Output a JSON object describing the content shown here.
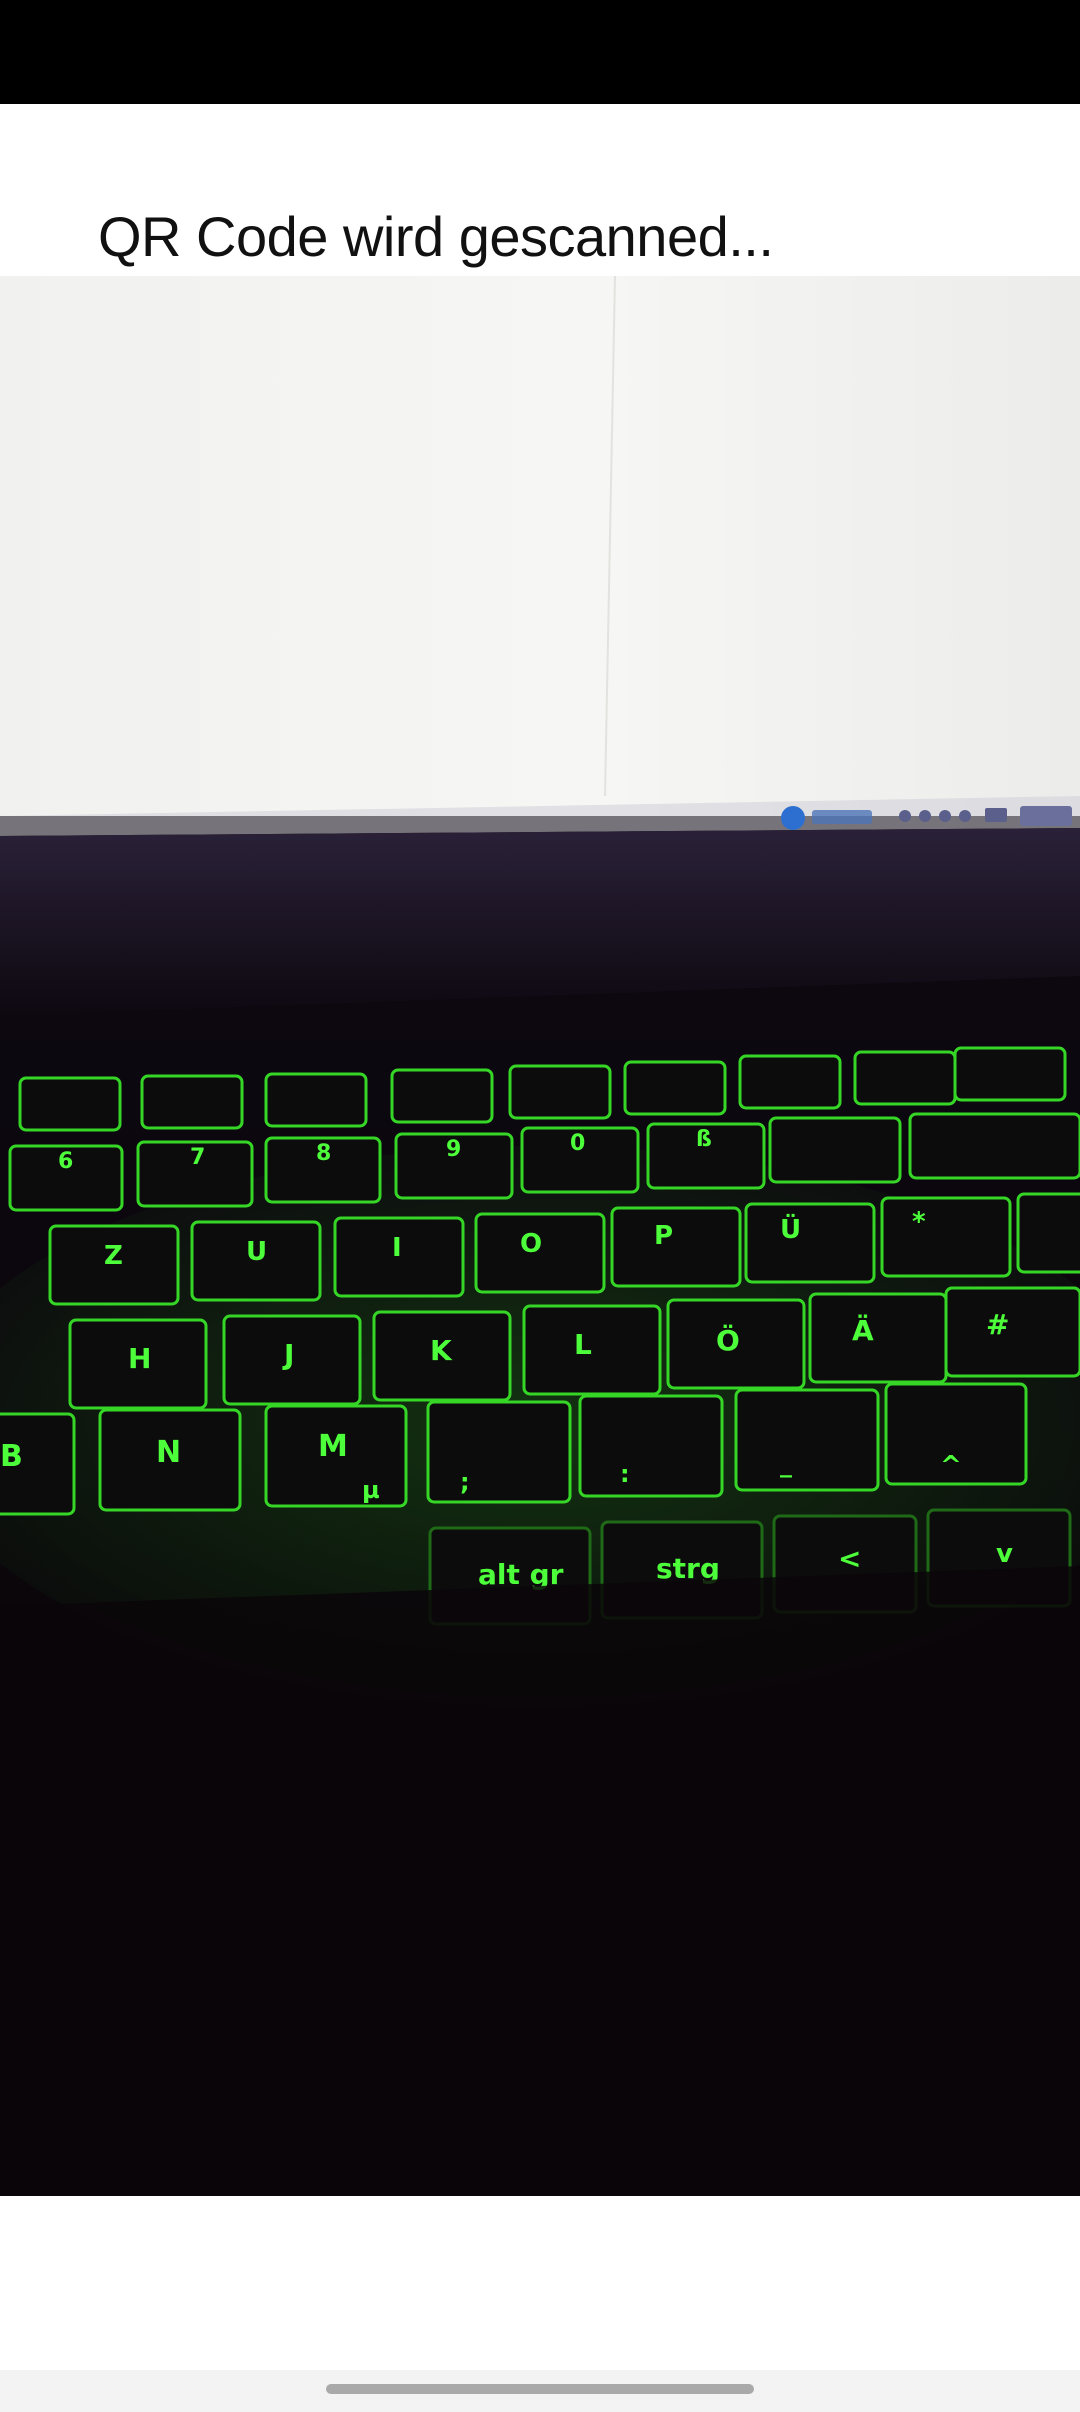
{
  "scanner": {
    "title": "QR Code wird gescanned..."
  },
  "camera": {
    "keyboard_keys": {
      "row_numbers": [
        "6",
        "7",
        "8",
        "9",
        "0",
        "ß"
      ],
      "row_top": [
        "Z",
        "U",
        "I",
        "O",
        "P",
        "Ü",
        "*"
      ],
      "row_home": [
        "H",
        "J",
        "K",
        "L",
        "Ö",
        "Ä",
        "#"
      ],
      "row_bottom": [
        "B",
        "N",
        "M",
        "µ",
        ";",
        ":",
        "_"
      ],
      "row_modifiers": [
        "alt gr",
        "strg",
        "<",
        "^",
        "v"
      ]
    }
  },
  "colors": {
    "status_bar": "#000000",
    "background": "#ffffff",
    "key_backlight": "#4dff3a",
    "laptop_body": "#0a0508",
    "screen_glow": "#f4f4f2"
  }
}
